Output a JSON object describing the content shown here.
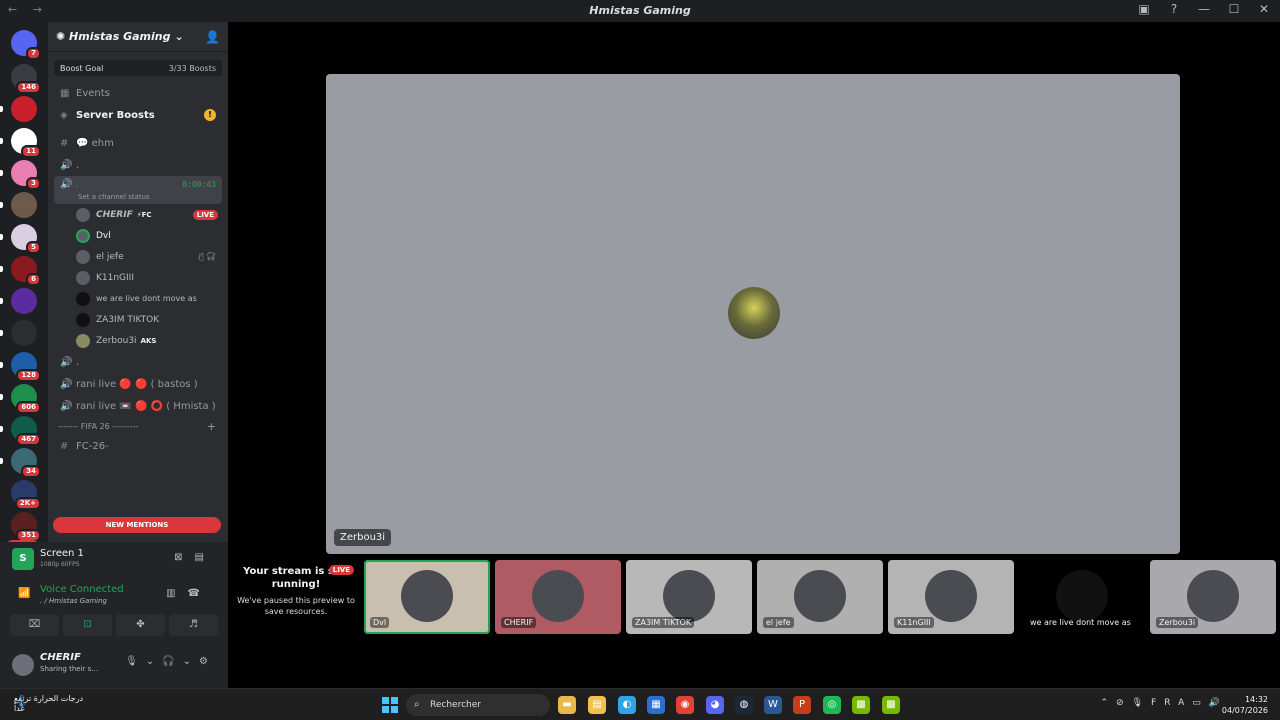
{
  "window": {
    "nav": "← →",
    "title": "Hmistas Gaming",
    "controls": [
      "▣",
      "?",
      "—",
      "☐",
      "✕"
    ]
  },
  "servers": {
    "badges": [
      "7",
      "146",
      "",
      "11",
      "3",
      "",
      "5",
      "6",
      "",
      "",
      "128",
      "606",
      "467",
      "34",
      "2K+",
      "351"
    ],
    "new_label": "NEW",
    "colors": [
      "#5865f2",
      "#3a3c42",
      "#c8202a",
      "#ffffff",
      "#e87fb0",
      "#6e5a4a",
      "#d9cfe0",
      "#8a1a20",
      "#5b2ca0",
      "#2b2d31",
      "#1d5ea8",
      "#1f8f4e",
      "#0f5c4a",
      "#3a6b75",
      "#2a3a6a",
      "#5a2020"
    ]
  },
  "sidebar": {
    "server_name": "Hmistas Gaming",
    "boost_goal": "Boost Goal",
    "boost_count": "3/33 Boosts",
    "events": "Events",
    "server_boosts": "Server Boosts",
    "channels": [
      {
        "name": "ehm",
        "icon": "#"
      },
      {
        "name": ".",
        "icon": "🔊"
      }
    ],
    "active_channel": {
      "name": ".",
      "time": "8:00:43",
      "status": "Set a channel status"
    },
    "voice_users": [
      {
        "name": "CHERIF",
        "tag": "⚡FC",
        "live": "LIVE"
      },
      {
        "name": "Dvl"
      },
      {
        "name": "el jefe"
      },
      {
        "name": "K11nGIII"
      },
      {
        "name": "we are live dont move as"
      },
      {
        "name": "ZA3IM TIKTOK"
      },
      {
        "name": "Zerbou3i",
        "tag": "AKS"
      }
    ],
    "channels_after": [
      {
        "name": ".",
        "icon": "🔊"
      },
      {
        "name": "rani live 🔴 🔴 ( bastos )",
        "icon": "🔊"
      },
      {
        "name": "rani live 📼 🔴 ⭕ ( Hmista )",
        "icon": "🔊"
      }
    ],
    "category": "------- FIFA 26 ---------",
    "category_channel": "FC-26-",
    "new_mentions": "NEW MENTIONS"
  },
  "panel": {
    "screen_title": "Screen 1",
    "screen_sub": "1080p 60FPS",
    "voice_title": "Voice Connected",
    "voice_sub": ". / Hmistas Gaming",
    "user_name": "CHERIF",
    "user_status": "Sharing their s..."
  },
  "stage": {
    "label": "Zerbou3i"
  },
  "paused": {
    "heading": "Your stream is still running!",
    "body": "We've paused this preview to save resources.",
    "live": "LIVE",
    "who": "CHERIF"
  },
  "tiles": [
    {
      "label": "Dvl",
      "bg": "#c8bfae",
      "selected": true
    },
    {
      "label": "CHERIF",
      "bg": "#b05a64"
    },
    {
      "label": "ZA3IM TIKTOK",
      "bg": "#b8b8b8"
    },
    {
      "label": "el jefe",
      "bg": "#b0b0b0"
    },
    {
      "label": "K11nGIII",
      "bg": "#b4b4b4"
    },
    {
      "label": "we are live dont move as",
      "bg": "#000000"
    },
    {
      "label": "Zerbou3i",
      "bg": "#a9a9ad"
    }
  ],
  "taskbar": {
    "weather": "درجات الحرارة ترتفع",
    "weather_sub": "غداً",
    "search_placeholder": "Rechercher",
    "lang": "FRA",
    "time": "14:32",
    "date": "04/07/2026",
    "apps": [
      {
        "name": "file-explorer-icon",
        "glyph": "▬",
        "color": "#e8b84a"
      },
      {
        "name": "folder-icon",
        "glyph": "▤",
        "color": "#f3c14b"
      },
      {
        "name": "edge-icon",
        "glyph": "◐",
        "color": "#2fa4e7"
      },
      {
        "name": "store-icon",
        "glyph": "▦",
        "color": "#2d6fd1"
      },
      {
        "name": "chrome-icon",
        "glyph": "◉",
        "color": "#e34133"
      },
      {
        "name": "discord-icon",
        "glyph": "◕",
        "color": "#5865f2"
      },
      {
        "name": "steam-icon",
        "glyph": "◍",
        "color": "#1b2838"
      },
      {
        "name": "word-icon",
        "glyph": "W",
        "color": "#2b5797"
      },
      {
        "name": "powerpoint-icon",
        "glyph": "P",
        "color": "#c43e1c"
      },
      {
        "name": "spotify-icon",
        "glyph": "◎",
        "color": "#1db954"
      },
      {
        "name": "nvidia-icon",
        "glyph": "▩",
        "color": "#76b900"
      },
      {
        "name": "nvidia-app-icon",
        "glyph": "▩",
        "color": "#76b900"
      }
    ]
  }
}
